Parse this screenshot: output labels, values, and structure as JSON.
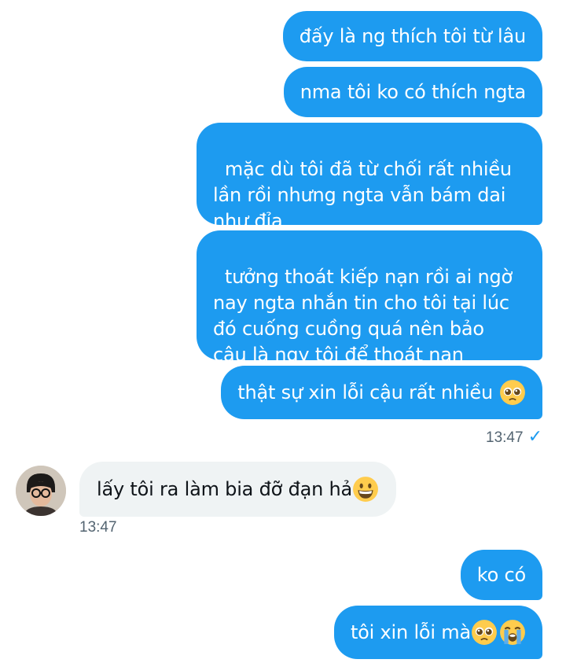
{
  "messages_out_1": [
    "đấy là ng thích tôi từ lâu",
    "nma tôi ko có thích ngta",
    "mặc dù tôi đã từ chối rất nhiều\nlần rồi nhưng ngta vẫn bám dai\nnhư đỉa",
    "tưởng thoát kiếp nạn rồi ai ngờ\nnay ngta nhắn tin cho tôi tại lúc\nđó cuống cuồng quá nên bảo\ncậu là ngy tôi để thoát nạn",
    "thật sự xin lỗi cậu rất nhiều"
  ],
  "timestamp_out": "13:47",
  "incoming": {
    "text": "lấy tôi ra làm bia đỡ đạn hả",
    "timestamp": "13:47",
    "avatar_icon": "profile-avatar"
  },
  "messages_out_2": [
    "ko có",
    "tôi xin lỗi mà"
  ],
  "colors": {
    "outgoing_bubble": "#1d9bf0",
    "incoming_bubble": "#eff3f4",
    "timestamp": "#536471"
  },
  "icons": [
    "pleading-face-emoji",
    "grinning-face-emoji",
    "crying-face-emoji",
    "read-check-icon"
  ]
}
